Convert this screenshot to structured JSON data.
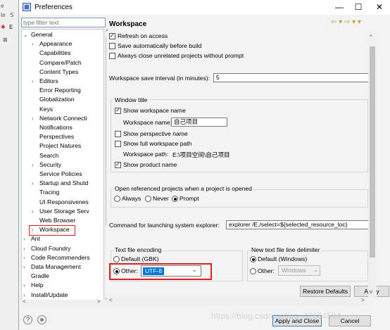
{
  "background": {
    "texts": [
      "e",
      "te",
      "S",
      "E",
      "⊠"
    ]
  },
  "window": {
    "title": "Preferences",
    "minimize": "—",
    "maximize": "☐",
    "close": "✕"
  },
  "filter": {
    "placeholder": "type filter text"
  },
  "tree": [
    {
      "label": "General",
      "arrow": "v",
      "level": 0
    },
    {
      "label": "Appearance",
      "arrow": ">",
      "level": 1
    },
    {
      "label": "Capabilities",
      "arrow": "",
      "level": 1
    },
    {
      "label": "Compare/Patch",
      "arrow": "",
      "level": 1
    },
    {
      "label": "Content Types",
      "arrow": "",
      "level": 1
    },
    {
      "label": "Editors",
      "arrow": ">",
      "level": 1
    },
    {
      "label": "Error Reporting",
      "arrow": "",
      "level": 1
    },
    {
      "label": "Globalization",
      "arrow": "",
      "level": 1
    },
    {
      "label": "Keys",
      "arrow": "",
      "level": 1
    },
    {
      "label": "Network Connecti",
      "arrow": ">",
      "level": 1
    },
    {
      "label": "Notifications",
      "arrow": "",
      "level": 1
    },
    {
      "label": "Perspectives",
      "arrow": "",
      "level": 1
    },
    {
      "label": "Project Natures",
      "arrow": "",
      "level": 1
    },
    {
      "label": "Search",
      "arrow": "",
      "level": 1
    },
    {
      "label": "Security",
      "arrow": ">",
      "level": 1
    },
    {
      "label": "Service Policies",
      "arrow": "",
      "level": 1
    },
    {
      "label": "Startup and Shutd",
      "arrow": ">",
      "level": 1
    },
    {
      "label": "Tracing",
      "arrow": "",
      "level": 1
    },
    {
      "label": "UI Responsivenes",
      "arrow": "",
      "level": 1
    },
    {
      "label": "User Storage Serv",
      "arrow": ">",
      "level": 1
    },
    {
      "label": "Web Browser",
      "arrow": "",
      "level": 1
    },
    {
      "label": "Workspace",
      "arrow": ">",
      "level": 1
    },
    {
      "label": "Ant",
      "arrow": ">",
      "level": 0
    },
    {
      "label": "Cloud Foundry",
      "arrow": ">",
      "level": 0
    },
    {
      "label": "Code Recommenders",
      "arrow": ">",
      "level": 0
    },
    {
      "label": "Data Management",
      "arrow": ">",
      "level": 0
    },
    {
      "label": "Gradle",
      "arrow": "",
      "level": 0
    },
    {
      "label": "Help",
      "arrow": ">",
      "level": 0
    },
    {
      "label": "Install/Update",
      "arrow": ">",
      "level": 0
    }
  ],
  "page": {
    "title": "Workspace",
    "nav": "⇦ ▾ ⇨ ▾ ▾",
    "refresh_on_access": "Refresh on access",
    "save_auto": "Save automatically before build",
    "always_close": "Always close unrelated projects without prompt",
    "save_interval_label": "Workspace save interval (in minutes):",
    "save_interval_value": "5",
    "window_title_group": "Window title",
    "show_ws_name": "Show workspace name",
    "ws_name_label": "Workspace name:",
    "ws_name_value": "自己项目",
    "show_perspective": "Show perspective name",
    "show_full_path": "Show full workspace path",
    "ws_path_label": "Workspace path:",
    "ws_path_value": "E:\\项目空间\\自己项目",
    "show_product": "Show product name",
    "open_ref_group": "Open referenced projects when a project is opened",
    "opt_always": "Always",
    "opt_never": "Never",
    "opt_prompt": "Prompt",
    "explorer_label": "Command for launching system explorer:",
    "explorer_value": "explorer /E,/select=${selected_resource_loc}",
    "encoding_group": "Text file encoding",
    "enc_default": "Default (GBK)",
    "enc_other": "Other:",
    "enc_other_value": "UTF-8",
    "delim_group": "New text file line delimiter",
    "delim_default": "Default (Windows)",
    "delim_other": "Other:",
    "delim_other_value": "Windows",
    "restore_defaults": "Restore Defaults",
    "apply": "Apply"
  },
  "footer": {
    "help": "?",
    "apply_close": "Apply and Close",
    "cancel": "Cancel",
    "watermark": "https://blog.csdn.net/qq_42684504"
  }
}
